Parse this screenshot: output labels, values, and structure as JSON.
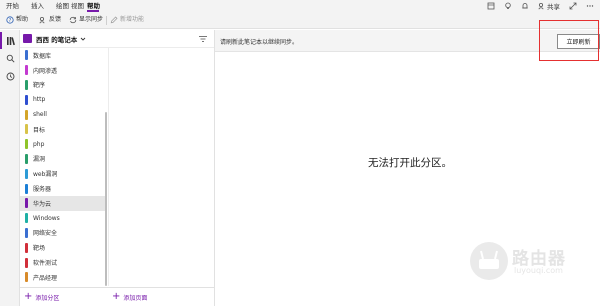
{
  "ribbon": {
    "tabs": [
      "开始",
      "插入",
      "绘图",
      "视图",
      "帮助"
    ],
    "active_tab": "帮助",
    "share_label": "共享"
  },
  "commands": {
    "help": "帮助",
    "feedback": "反馈",
    "show_sync": "显示同步",
    "new_features": "新增功能"
  },
  "notebook": {
    "title": "西西 的笔记本"
  },
  "sections": [
    {
      "label": "数据库",
      "color": "#3b6fd1"
    },
    {
      "label": "内网渗透",
      "color": "#c33ad0"
    },
    {
      "label": "靶序",
      "color": "#2a9e6b"
    },
    {
      "label": "http",
      "color": "#2f4fd0"
    },
    {
      "label": "shell",
      "color": "#d4a52a"
    },
    {
      "label": "目标",
      "color": "#d8c34a"
    },
    {
      "label": "php",
      "color": "#8fc42a"
    },
    {
      "label": "漏洞",
      "color": "#2a9e6b"
    },
    {
      "label": "web漏洞",
      "color": "#2d9bd6"
    },
    {
      "label": "服务器",
      "color": "#1c7fd6"
    },
    {
      "label": "华为云",
      "color": "#7719aa"
    },
    {
      "label": "Windows",
      "color": "#1fb0a5"
    },
    {
      "label": "网络安全",
      "color": "#3b6fd1"
    },
    {
      "label": "靶场",
      "color": "#d12f3a"
    },
    {
      "label": "软件测试",
      "color": "#d12f3a"
    },
    {
      "label": "产品经理",
      "color": "#d88b2a"
    }
  ],
  "selected_section": "华为云",
  "bottom": {
    "add_section": "添加分区",
    "add_page": "添加页面"
  },
  "notice": {
    "text": "请刷新此笔记本以继续同步。",
    "button": "立即刷新"
  },
  "main_message": "无法打开此分区。",
  "watermark": {
    "name": "路由器",
    "url": "luyouqi.com"
  },
  "colors": {
    "accent": "#7719aa",
    "highlight": "#e53030"
  }
}
